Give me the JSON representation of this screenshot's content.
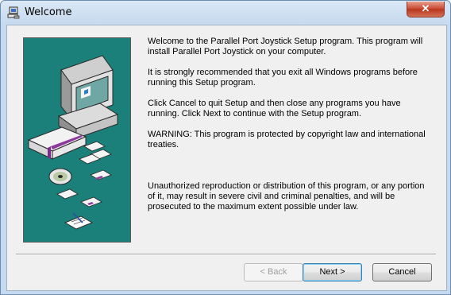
{
  "window": {
    "title": "Welcome",
    "close_glyph": "✕"
  },
  "icons": {
    "title": "setup-computer-icon",
    "close": "close-icon"
  },
  "content": {
    "paragraphs": [
      "Welcome to the Parallel Port Joystick Setup program.  This program will install Parallel Port Joystick on your computer.",
      "It is strongly recommended that you exit all Windows programs before running this Setup program.",
      "Click Cancel to quit Setup and then close any programs you have running.  Click Next to continue with the Setup program.",
      "WARNING: This program is protected by copyright law and international treaties.",
      "Unauthorized reproduction or distribution of this program, or any portion of it, may result in severe civil and criminal penalties, and will be prosecuted to the maximum extent possible under law."
    ]
  },
  "buttons": {
    "back": "< Back",
    "next": "Next >",
    "cancel": "Cancel"
  },
  "colors": {
    "art_background": "#1b7f7a",
    "close_button": "#c7452b"
  }
}
